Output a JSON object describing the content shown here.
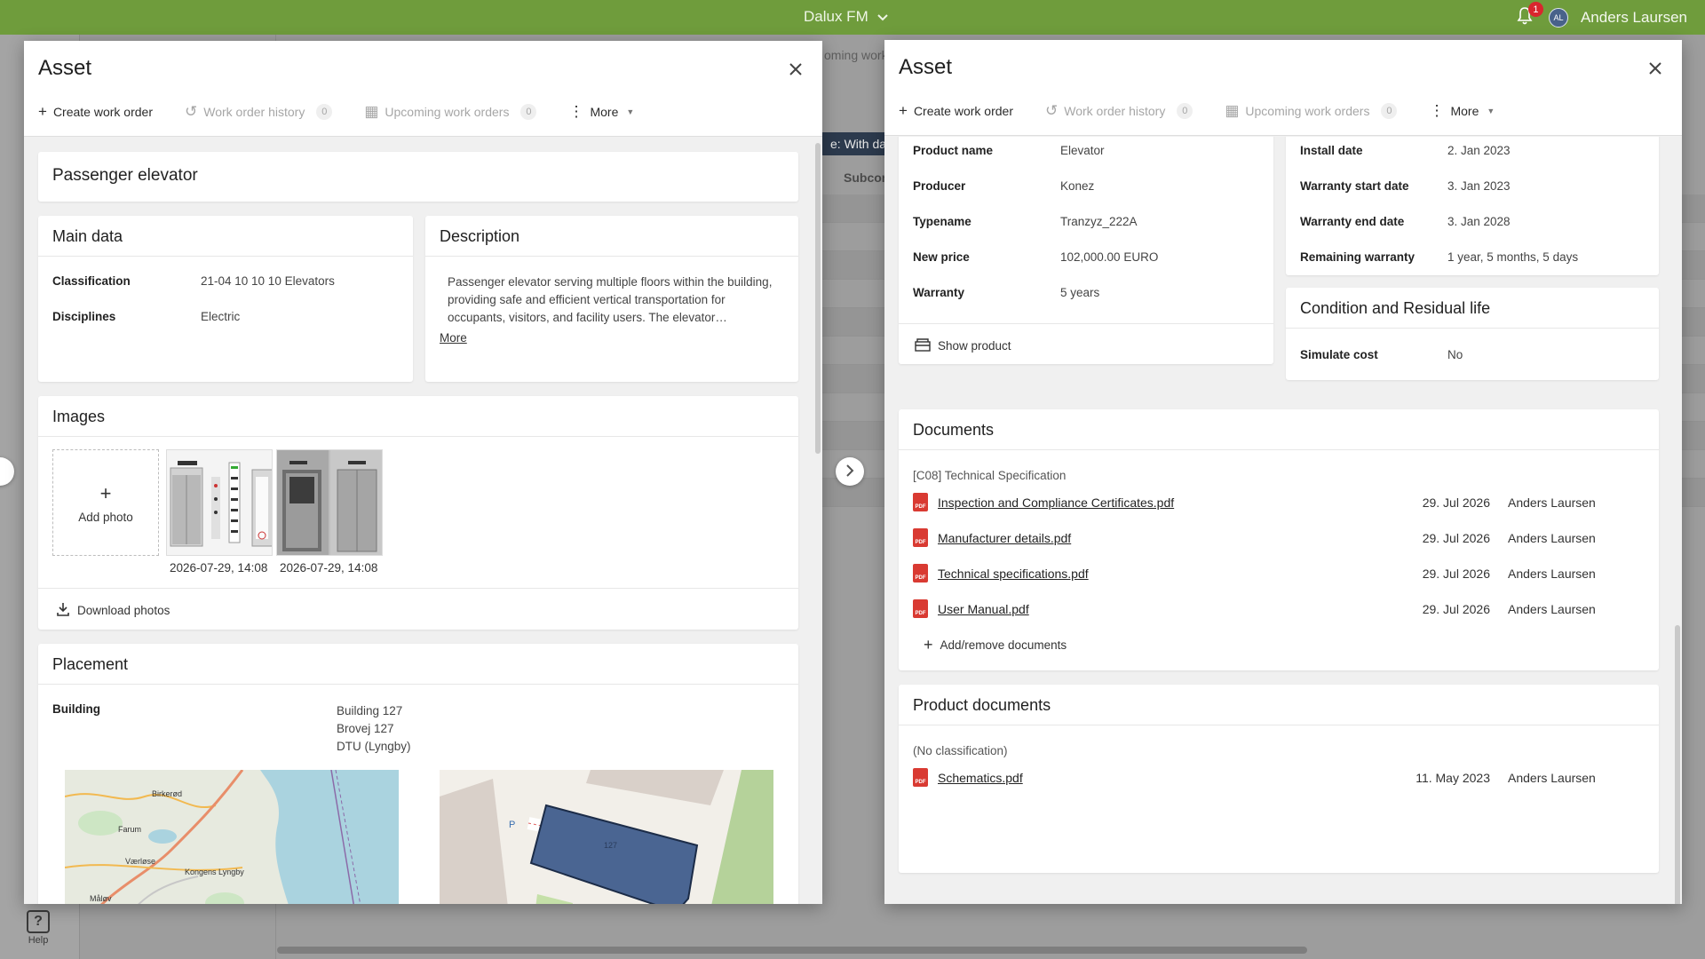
{
  "topbar": {
    "app_name": "Dalux FM",
    "notification_count": "1",
    "user_initials": "AL",
    "user_name": "Anders Laursen"
  },
  "background": {
    "filter_chip": "e:  With dat",
    "tab_fragment": "oming work",
    "column_fragment": "Subcor",
    "help_label": "Help"
  },
  "left_modal": {
    "title": "Asset",
    "toolbar": {
      "create": "Create work order",
      "history": "Work order history",
      "history_count": "0",
      "upcoming": "Upcoming work orders",
      "upcoming_count": "0",
      "more": "More"
    },
    "asset_name": "Passenger elevator",
    "main_data": {
      "title": "Main data",
      "rows": [
        {
          "key": "Classification",
          "value": "21-04 10 10 10 Elevators"
        },
        {
          "key": "Disciplines",
          "value": "Electric"
        }
      ]
    },
    "description": {
      "title": "Description",
      "text": "Passenger elevator serving multiple floors within the building, providing safe and efficient vertical transportation for occupants, visitors, and facility users. The elevator…",
      "more": "More"
    },
    "images": {
      "title": "Images",
      "add_photo": "Add photo",
      "captions": [
        "2026-07-29, 14:08",
        "2026-07-29, 14:08"
      ],
      "download": "Download photos"
    },
    "placement": {
      "title": "Placement",
      "key": "Building",
      "lines": [
        "Building 127",
        "Brovej 127",
        "DTU (Lyngby)"
      ],
      "map_labels": [
        "Birkerød",
        "Farum",
        "Værløse",
        "Kongens Lyngby",
        "Måløv"
      ],
      "building_label": "127"
    }
  },
  "right_modal": {
    "title": "Asset",
    "toolbar": {
      "create": "Create work order",
      "history": "Work order history",
      "history_count": "0",
      "upcoming": "Upcoming work orders",
      "upcoming_count": "0",
      "more": "More"
    },
    "product": {
      "rows": [
        {
          "key": "Product name",
          "value": "Elevator"
        },
        {
          "key": "Producer",
          "value": "Konez"
        },
        {
          "key": "Typename",
          "value": "Tranzyz_222A"
        },
        {
          "key": "New price",
          "value": "102,000.00 EURO"
        },
        {
          "key": "Warranty",
          "value": "5 years"
        }
      ],
      "show_product": "Show product"
    },
    "warranty": {
      "rows": [
        {
          "key": "Install date",
          "value": "2. Jan 2023"
        },
        {
          "key": "Warranty start date",
          "value": "3. Jan 2023"
        },
        {
          "key": "Warranty end date",
          "value": "3. Jan 2028"
        },
        {
          "key": "Remaining warranty",
          "value": "1 year, 5 months, 5 days"
        }
      ]
    },
    "condition": {
      "title": "Condition and Residual life",
      "key": "Simulate cost",
      "value": "No"
    },
    "documents": {
      "title": "Documents",
      "group": "[C08] Technical Specification",
      "items": [
        {
          "name": "Inspection and Compliance Certificates.pdf",
          "date": "29. Jul 2026",
          "user": "Anders Laursen"
        },
        {
          "name": "Manufacturer details.pdf",
          "date": "29. Jul 2026",
          "user": "Anders Laursen"
        },
        {
          "name": "Technical specifications.pdf",
          "date": "29. Jul 2026",
          "user": "Anders Laursen"
        },
        {
          "name": "User Manual.pdf",
          "date": "29. Jul 2026",
          "user": "Anders Laursen"
        }
      ],
      "add_remove": "Add/remove documents"
    },
    "product_documents": {
      "title": "Product documents",
      "group": "(No classification)",
      "items": [
        {
          "name": "Schematics.pdf",
          "date": "11. May 2023",
          "user": "Anders Laursen"
        }
      ]
    }
  },
  "colors": {
    "topbar": "#6f9c3c",
    "pdf": "#d93a32",
    "building_fill": "#4a6592"
  }
}
